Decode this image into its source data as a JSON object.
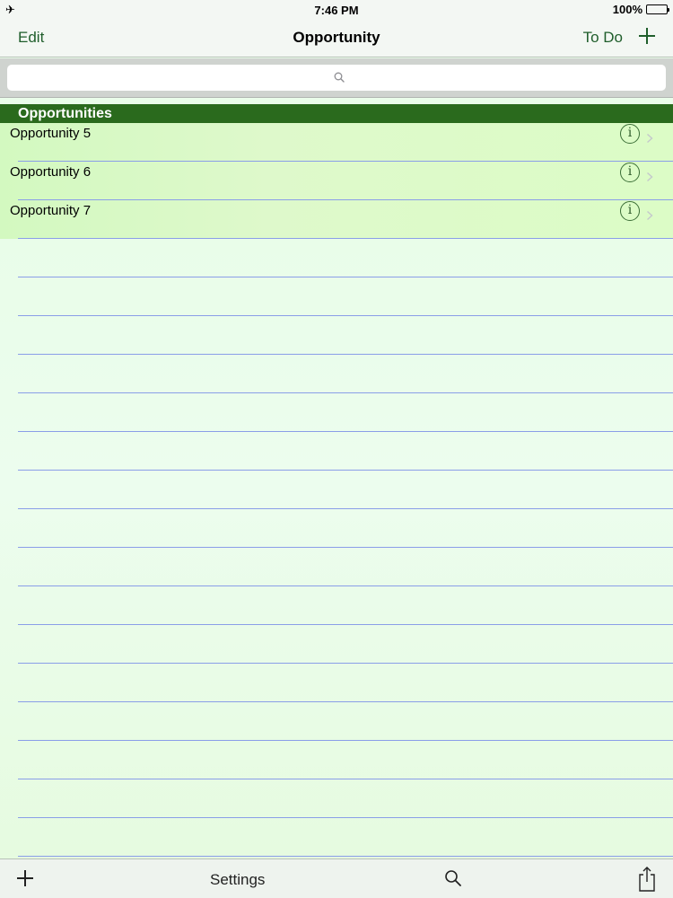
{
  "status_bar": {
    "airplane_icon": "airplane-icon",
    "time": "7:46 PM",
    "battery": "100%"
  },
  "nav_bar": {
    "edit_label": "Edit",
    "title": "Opportunity",
    "todo_label": "To Do",
    "add_icon": "plus-icon"
  },
  "search": {
    "placeholder": "",
    "icon": "search-icon"
  },
  "section": {
    "title": "Opportunities"
  },
  "list": {
    "items": [
      {
        "label": "Opportunity 5"
      },
      {
        "label": "Opportunity 6"
      },
      {
        "label": "Opportunity 7"
      }
    ]
  },
  "toolbar": {
    "add_icon": "plus-icon",
    "settings_label": "Settings",
    "search_icon": "search-icon",
    "share_icon": "share-icon"
  },
  "colors": {
    "accent": "#1f5e2b",
    "section_header": "#2a6a1d",
    "row_background": "#d3f9c0",
    "page_background": "#eafdea",
    "rule_line": "#8a9ee8"
  }
}
